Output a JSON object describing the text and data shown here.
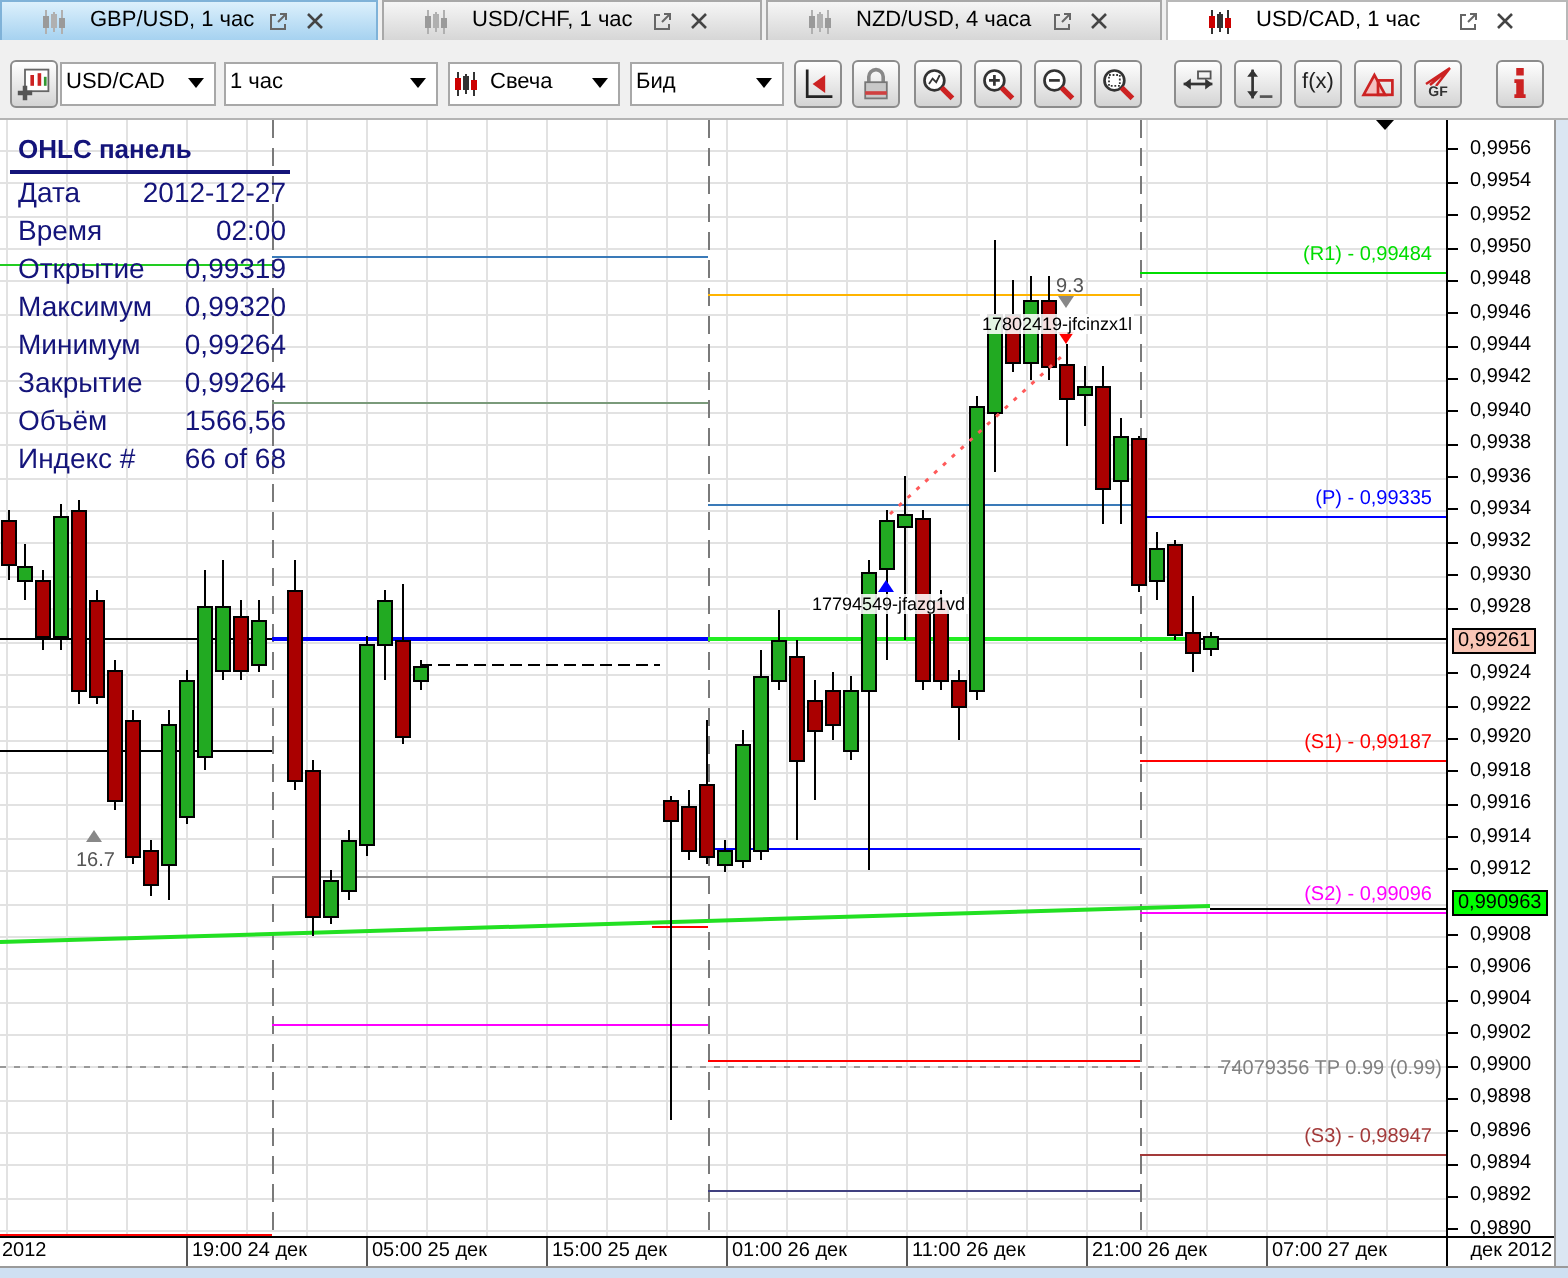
{
  "tabs": [
    {
      "label": "GBP/USD, 1 час",
      "selected": false,
      "hovered": true
    },
    {
      "label": "USD/CHF, 1 час",
      "selected": false,
      "hovered": false
    },
    {
      "label": "NZD/USD, 4 часа",
      "selected": false,
      "hovered": false
    },
    {
      "label": "USD/CAD, 1 час",
      "selected": true,
      "hovered": false
    }
  ],
  "toolbar": {
    "selects": [
      {
        "kind": "instrument",
        "value": "USD/CAD"
      },
      {
        "kind": "period",
        "value": "1 час"
      },
      {
        "kind": "chart_type",
        "value": "Свеча"
      },
      {
        "kind": "price_side",
        "value": "Бид"
      }
    ],
    "formula_button": {
      "label": "f(x)"
    },
    "fan_button": {
      "label": "GF"
    }
  },
  "ohlc_panel": {
    "title": "OHLC панель",
    "rows": [
      {
        "label": "Дата",
        "value": "2012-12-27"
      },
      {
        "label": "Время",
        "value": "02:00"
      },
      {
        "label": "Открытие",
        "value": "0,99319"
      },
      {
        "label": "Максимум",
        "value": "0,99320"
      },
      {
        "label": "Минимум",
        "value": "0,99264"
      },
      {
        "label": "Закрытие",
        "value": "0,99264"
      },
      {
        "label": "Объём",
        "value": "1566,56"
      },
      {
        "label": "Индекс #",
        "value": "66 of 68"
      }
    ]
  },
  "chart": {
    "pivot_labels": [
      {
        "label": "(R1) - 0,99484",
        "color": "#00dd00"
      },
      {
        "label": "(P) - 0,99335",
        "color": "#0000ff"
      },
      {
        "label": "(S1) - 0,99187",
        "color": "#ff0000"
      },
      {
        "label": "(S2) - 0,99096",
        "color": "#ff00ff"
      },
      {
        "label": "(S3) - 0,98947",
        "color": "#a33a3a"
      }
    ],
    "take_profit": {
      "label": "74079356 TP 0.99 (0.99)"
    },
    "markers": [
      {
        "kind": "up",
        "label": "16.7"
      },
      {
        "kind": "down",
        "label": "9.3"
      }
    ],
    "orders": [
      {
        "kind": "buy",
        "label": "17794549-jfazg1vd"
      },
      {
        "kind": "sell",
        "label": "17802419-jfcinzx1l"
      }
    ],
    "price_axis": [
      {
        "kind": "tick",
        "label": "0,9956"
      },
      {
        "kind": "tick",
        "label": "0,9954"
      },
      {
        "kind": "tick",
        "label": "0,9952"
      },
      {
        "kind": "tick",
        "label": "0,9950"
      },
      {
        "kind": "tick",
        "label": "0,9948"
      },
      {
        "kind": "tick",
        "label": "0,9946"
      },
      {
        "kind": "tick",
        "label": "0,9944"
      },
      {
        "kind": "tick",
        "label": "0,9942"
      },
      {
        "kind": "tick",
        "label": "0,9940"
      },
      {
        "kind": "tick",
        "label": "0,9938"
      },
      {
        "kind": "tick",
        "label": "0,9936"
      },
      {
        "kind": "tick",
        "label": "0,9934"
      },
      {
        "kind": "tick",
        "label": "0,9932"
      },
      {
        "kind": "tick",
        "label": "0,9930"
      },
      {
        "kind": "tick",
        "label": "0,9928"
      },
      {
        "kind": "badge",
        "label": "0,99261",
        "color": "#f9c6b6"
      },
      {
        "kind": "tick",
        "label": "0,9924"
      },
      {
        "kind": "tick",
        "label": "0,9922"
      },
      {
        "kind": "tick",
        "label": "0,9920"
      },
      {
        "kind": "tick",
        "label": "0,9918"
      },
      {
        "kind": "tick",
        "label": "0,9916"
      },
      {
        "kind": "tick",
        "label": "0,9914"
      },
      {
        "kind": "tick",
        "label": "0,9912"
      },
      {
        "kind": "badge",
        "label": "0,990963",
        "color": "#00ff00"
      },
      {
        "kind": "tick",
        "label": "0,9908"
      },
      {
        "kind": "tick",
        "label": "0,9906"
      },
      {
        "kind": "tick",
        "label": "0,9904"
      },
      {
        "kind": "tick",
        "label": "0,9902"
      },
      {
        "kind": "tick",
        "label": "0,9900"
      },
      {
        "kind": "tick",
        "label": "0,9898"
      },
      {
        "kind": "tick",
        "label": "0,9896"
      },
      {
        "kind": "tick",
        "label": "0,9894"
      },
      {
        "kind": "tick",
        "label": "0,9892"
      },
      {
        "kind": "tick",
        "label": "0,9890"
      }
    ],
    "time_axis": [
      "2012",
      "19:00 24 дек",
      "05:00 25 дек",
      "15:00 25 дек",
      "01:00 26 дек",
      "11:00 26 дек",
      "21:00 26 дек",
      "07:00 27 дек",
      "дек 2012"
    ]
  }
}
